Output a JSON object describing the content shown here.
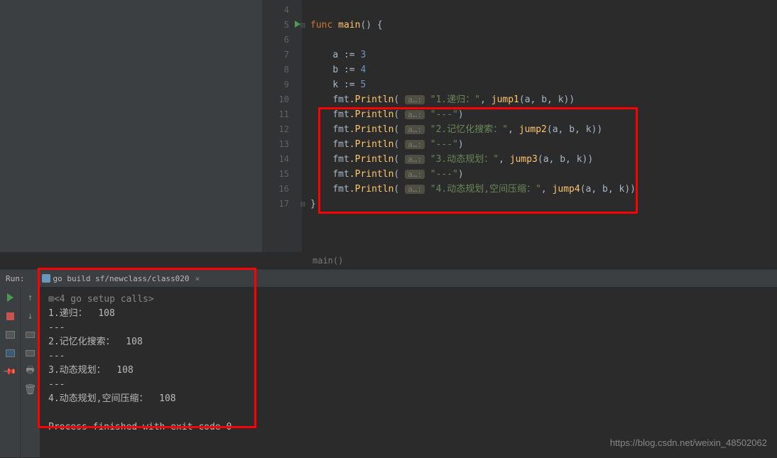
{
  "gutter": [
    "4",
    "5",
    "6",
    "7",
    "8",
    "9",
    "10",
    "11",
    "12",
    "13",
    "14",
    "15",
    "16",
    "17",
    ""
  ],
  "code": {
    "func_kw": "func",
    "main_fn": "main",
    "open": "() {",
    "a_decl": "a := ",
    "a_val": "3",
    "b_decl": "b := ",
    "b_val": "4",
    "k_decl": "k := ",
    "k_val": "5",
    "fmt": "fmt",
    "println": ".Println",
    "hint": "a…:",
    "str1": "\"1.递归：\"",
    "str2": "\"---\"",
    "str3": "\"2.记忆化搜索：\"",
    "str4": "\"---\"",
    "str5": "\"3.动态规划：\"",
    "str6": "\"---\"",
    "str7": "\"4.动态规划,空间压缩：\"",
    "jump1": "jump1",
    "jump2": "jump2",
    "jump3": "jump3",
    "jump4": "jump4",
    "args": "(a, b, k))",
    "a": "a",
    "b": "b",
    "k": "k",
    "close_brace": "}"
  },
  "breadcrumb": "main()",
  "run": {
    "title": "Run:",
    "tab": "go build sf/newclass/class020",
    "tab_close": "×"
  },
  "console": {
    "setup": "<4 go setup calls>",
    "line1": "1.递归：  108",
    "sep1": "---",
    "line2": "2.记忆化搜索：  108",
    "sep2": "---",
    "line3": "3.动态规划：  108",
    "sep3": "---",
    "line4": "4.动态规划,空间压缩：  108",
    "exit": "Process finished with exit code 0"
  },
  "watermark": "https://blog.csdn.net/weixin_48502062"
}
